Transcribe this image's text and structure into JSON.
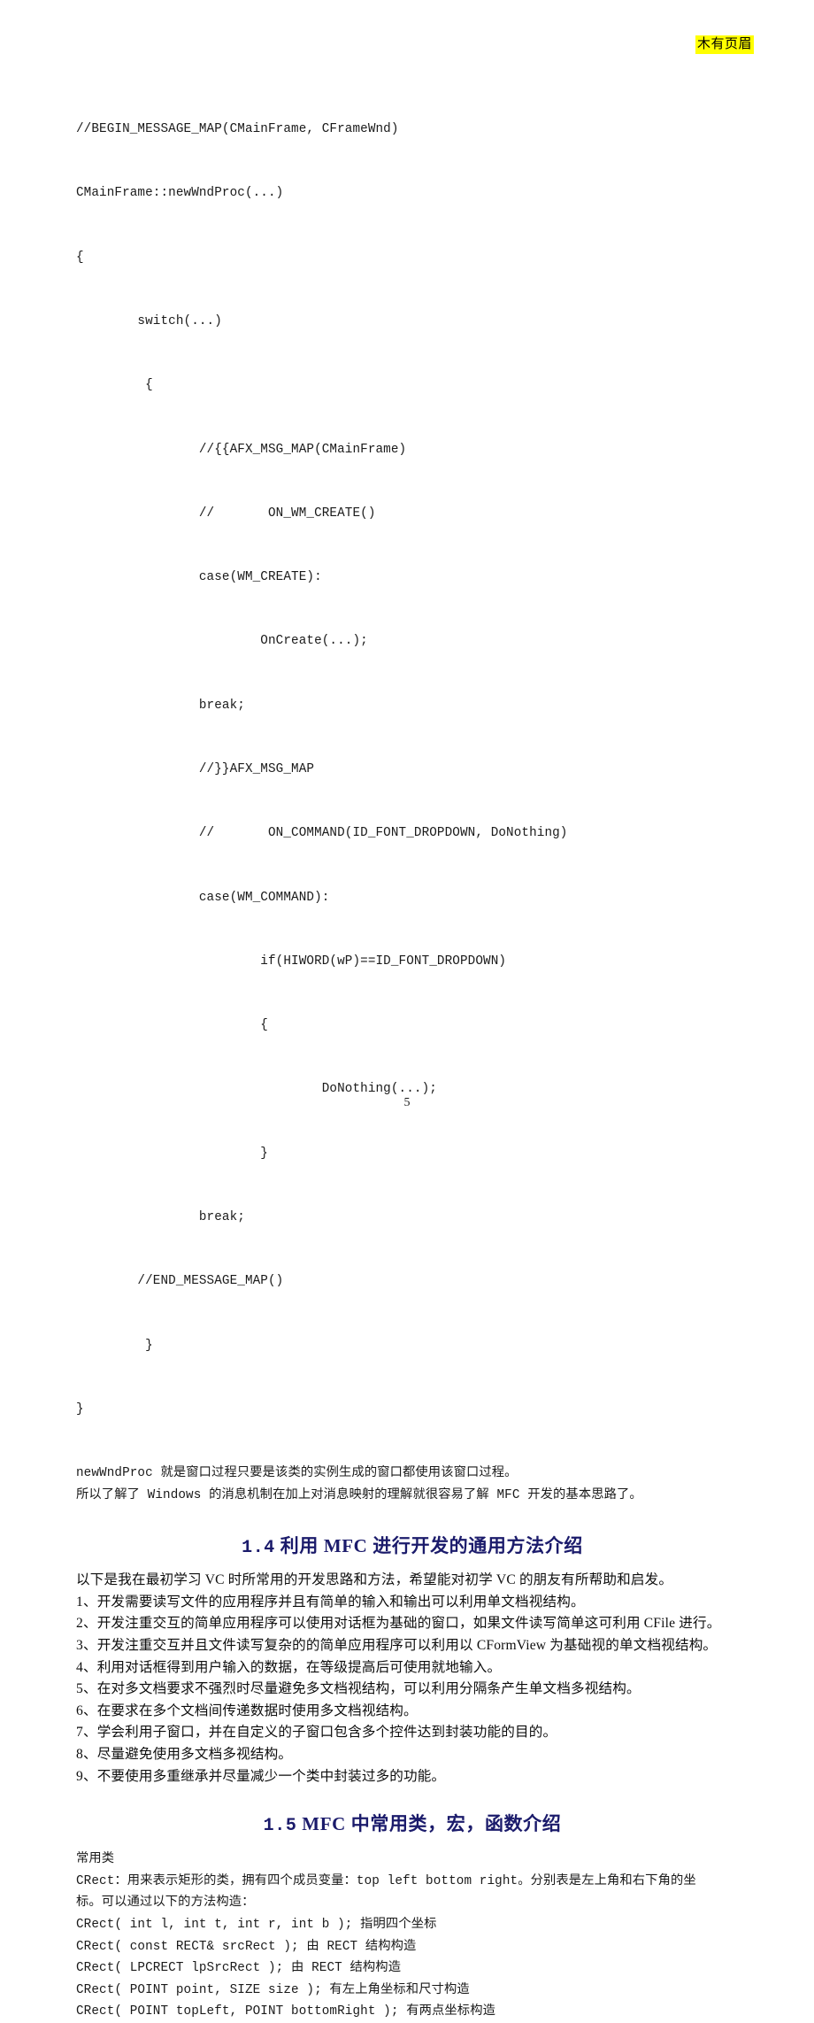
{
  "header": {
    "note": "木有页眉"
  },
  "code_block": {
    "lines": [
      "//BEGIN_MESSAGE_MAP(CMainFrame, CFrameWnd)",
      "CMainFrame::newWndProc(...)",
      "{",
      "        switch(...)",
      "         {",
      "                //{{AFX_MSG_MAP(CMainFrame)",
      "                //       ON_WM_CREATE()",
      "                case(WM_CREATE):",
      "                        OnCreate(...);",
      "                break;",
      "                //}}AFX_MSG_MAP",
      "                //       ON_COMMAND(ID_FONT_DROPDOWN, DoNothing)",
      "                case(WM_COMMAND):",
      "                        if(HIWORD(wP)==ID_FONT_DROPDOWN)",
      "                        {",
      "                                DoNothing(...);",
      "                        }",
      "                break;",
      "        //END_MESSAGE_MAP()",
      "         }",
      "}"
    ]
  },
  "post_code_paragraph": {
    "lines": [
      "newWndProc 就是窗口过程只要是该类的实例生成的窗口都使用该窗口过程。",
      "所以了解了 Windows 的消息机制在加上对消息映射的理解就很容易了解 MFC 开发的基本思路了。"
    ]
  },
  "section_1_4": {
    "number": "1.4",
    "title": "利用 MFC 进行开发的通用方法介绍",
    "intro": "以下是我在最初学习 VC 时所常用的开发思路和方法，希望能对初学 VC 的朋友有所帮助和启发。",
    "items": [
      "1、开发需要读写文件的应用程序并且有简单的输入和输出可以利用单文档视结构。",
      "2、开发注重交互的简单应用程序可以使用对话框为基础的窗口，如果文件读写简单这可利用 CFile 进行。",
      "3、开发注重交互并且文件读写复杂的的简单应用程序可以利用以 CFormView 为基础视的单文档视结构。",
      "4、利用对话框得到用户输入的数据，在等级提高后可使用就地输入。",
      "5、在对多文档要求不强烈时尽量避免多文档视结构，可以利用分隔条产生单文档多视结构。",
      "6、在要求在多个文档间传递数据时使用多文档视结构。",
      "7、学会利用子窗口，并在自定义的子窗口包含多个控件达到封装功能的目的。",
      "8、尽量避免使用多文档多视结构。",
      "9、不要使用多重继承并尽量减少一个类中封装过多的功能。"
    ]
  },
  "section_1_5": {
    "number": "1.5",
    "title": "MFC 中常用类，宏，函数介绍",
    "subtitle": "常用类",
    "description_lines": [
      "CRect：用来表示矩形的类，拥有四个成员变量：top left bottom right。分别表是左上角和右下角的坐",
      "标。可以通过以下的方法构造："
    ],
    "constructors": [
      "CRect( int l, int t, int r, int b ); 指明四个坐标",
      "CRect( const RECT& srcRect ); 由 RECT 结构构造",
      "CRect( LPCRECT lpSrcRect ); 由 RECT 结构构造",
      "CRect( POINT point, SIZE size ); 有左上角坐标和尺寸构造",
      "CRect( POINT topLeft, POINT bottomRight ); 有两点坐标构造"
    ]
  },
  "footer": {
    "page_number": "5"
  },
  "colors": {
    "heading": "#1b1b6b",
    "highlight": "#ffff00",
    "text": "#000000",
    "page_background": "#ffffff"
  }
}
